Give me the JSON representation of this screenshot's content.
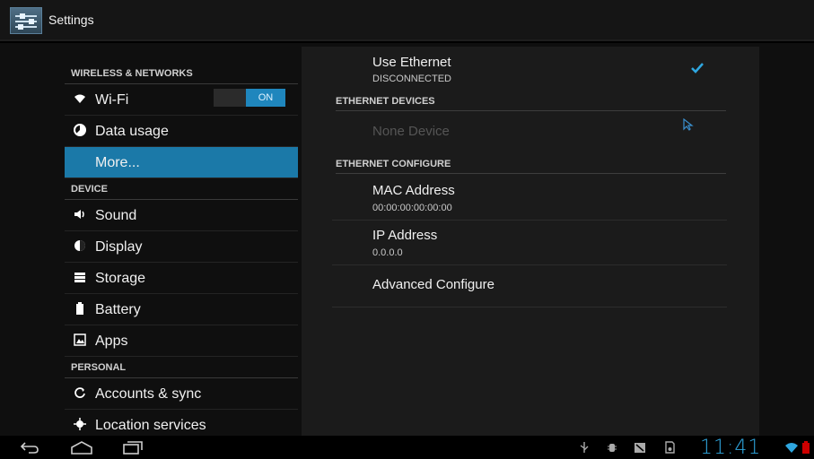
{
  "window": {
    "title": "Settings"
  },
  "sidebar": {
    "sections": [
      {
        "header": "WIRELESS & NETWORKS"
      },
      {
        "header": "DEVICE"
      },
      {
        "header": "PERSONAL"
      }
    ],
    "items": [
      {
        "label": "Wi-Fi",
        "icon": "wifi-icon",
        "toggle": "ON"
      },
      {
        "label": "Data usage",
        "icon": "data-usage-icon"
      },
      {
        "label": "More...",
        "selected": true
      },
      {
        "label": "Sound",
        "icon": "sound-icon"
      },
      {
        "label": "Display",
        "icon": "display-icon"
      },
      {
        "label": "Storage",
        "icon": "storage-icon"
      },
      {
        "label": "Battery",
        "icon": "battery-icon"
      },
      {
        "label": "Apps",
        "icon": "apps-icon"
      },
      {
        "label": "Accounts & sync",
        "icon": "sync-icon"
      },
      {
        "label": "Location services",
        "icon": "location-icon"
      }
    ]
  },
  "detail": {
    "use_ethernet": {
      "title": "Use Ethernet",
      "status": "DISCONNECTED",
      "checked": true
    },
    "devices_header": "ETHERNET DEVICES",
    "device_none": "None Device",
    "configure_header": "ETHERNET CONFIGURE",
    "mac": {
      "title": "MAC Address",
      "value": "00:00:00:00:00:00"
    },
    "ip": {
      "title": "IP Address",
      "value": "0.0.0.0"
    },
    "advanced": {
      "title": "Advanced Configure"
    }
  },
  "statusbar": {
    "time": "11:41"
  },
  "colors": {
    "accent": "#1b79a8",
    "clock": "#2fa7e0",
    "toggle_on": "#1f86bd"
  }
}
